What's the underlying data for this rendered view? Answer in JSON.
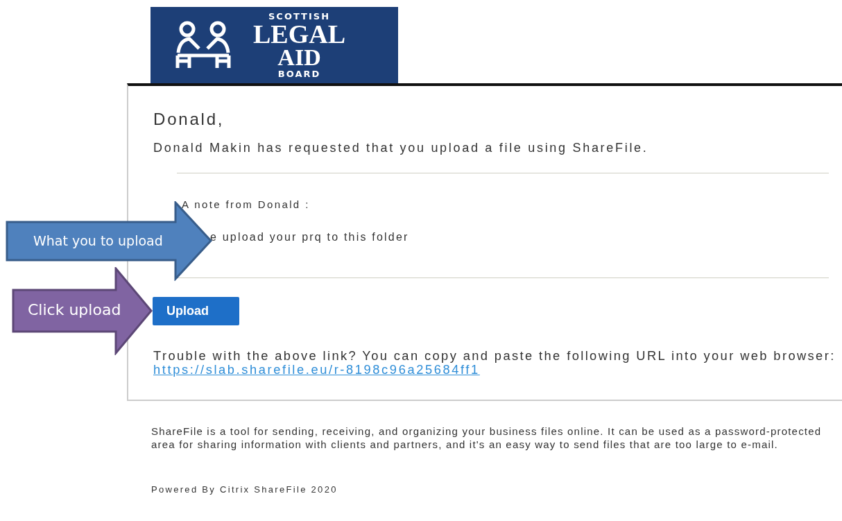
{
  "logo": {
    "lines": [
      "SCOTTISH",
      "LEGAL",
      "AID",
      "BOARD"
    ]
  },
  "email": {
    "greeting": "Donald,",
    "message": "Donald Makin has requested that you upload a file using ShareFile.",
    "note_label": "A note from Donald :",
    "note_text": "e upload your prq to this folder",
    "button": "Upload",
    "trouble_text": "Trouble with the above link? You can copy and paste the following URL into your web browser:",
    "link": "https://slab.sharefile.eu/r-8198c96a25684ff1"
  },
  "footer": {
    "about": "ShareFile is a tool for sending, receiving, and organizing your business files online. It can be used as a password-protected area for sharing information with clients and partners, and it's an easy way to send files that are too large to e-mail.",
    "powered_by": "Powered By Citrix ShareFile 2020"
  },
  "callouts": [
    {
      "label": "What you to upload",
      "color": "#4f81bd"
    },
    {
      "label": "Click upload",
      "color": "#8064a2"
    }
  ]
}
